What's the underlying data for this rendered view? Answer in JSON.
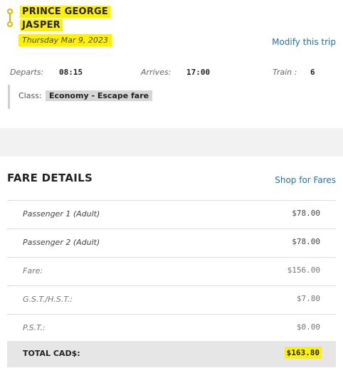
{
  "trip": {
    "origin": "PRINCE GEORGE",
    "destination": "JASPER",
    "date": "Thursday Mar 9, 2023",
    "modify_label": "Modify this trip",
    "departs_label": "Departs:",
    "departs_time": "08:15",
    "arrives_label": "Arrives:",
    "arrives_time": "17:00",
    "train_label": "Train :",
    "train_number": "6",
    "class_label": "Class:",
    "class_value": "Economy - Escape fare"
  },
  "fare_details": {
    "title": "FARE DETAILS",
    "shop_label": "Shop for Fares",
    "rows": [
      {
        "label": "Passenger 1  (Adult)",
        "amount": "$78.00"
      },
      {
        "label": "Passenger 2  (Adult)",
        "amount": "$78.00"
      },
      {
        "label": "Fare:",
        "amount": "$156.00"
      },
      {
        "label": "G.S.T./H.S.T.:",
        "amount": "$7.80"
      },
      {
        "label": "P.S.T.:",
        "amount": "$0.00"
      }
    ],
    "total_label": "TOTAL CAD$:",
    "total_amount": "$163.80"
  },
  "colors": {
    "highlight": "#fff200",
    "link": "#2b6f9a",
    "route_icon": "#e0b400"
  }
}
